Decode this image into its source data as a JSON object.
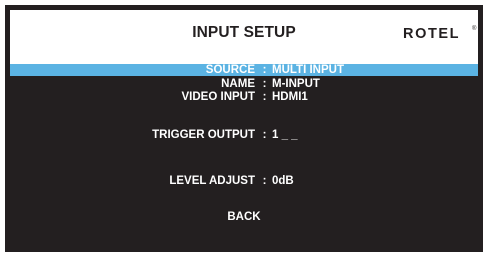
{
  "header": {
    "title": "INPUT SETUP",
    "brand": "ROTEL",
    "brand_mark": "®"
  },
  "colors": {
    "background": "#231f20",
    "header_background": "#ffffff",
    "selection": "#5bb3e3",
    "text": "#ffffff"
  },
  "menu": {
    "separator": ":",
    "rows": [
      {
        "label": "SOURCE",
        "value": "MULTI INPUT",
        "selected": true
      },
      {
        "label": "NAME",
        "value": "M-INPUT",
        "selected": false
      },
      {
        "label": "VIDEO INPUT",
        "value": "HDMI1",
        "selected": false
      },
      {
        "label": "TRIGGER OUTPUT",
        "value": "1 _ _",
        "selected": false
      },
      {
        "label": "LEVEL ADJUST",
        "value": "0dB",
        "selected": false
      }
    ],
    "back_label": "BACK"
  }
}
